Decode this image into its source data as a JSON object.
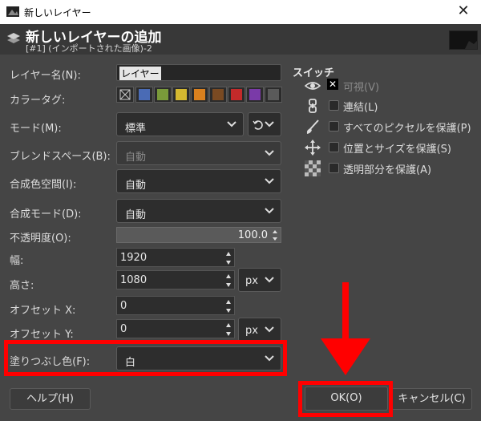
{
  "window": {
    "title": "新しいレイヤー"
  },
  "header": {
    "title": "新しいレイヤーの追加",
    "subtitle": "[#1] (インポートされた画像)-2"
  },
  "form": {
    "layer_name": {
      "label": "レイヤー名(N):",
      "value": "レイヤー"
    },
    "color_tag": {
      "label": "カラータグ:",
      "colors": [
        "#4a6bb5",
        "#7a9a3a",
        "#d4b830",
        "#d9801e",
        "#7a4a22",
        "#c42a2a",
        "#7a3aa8",
        "#5a5a5a"
      ]
    },
    "mode": {
      "label": "モード(M):",
      "value": "標準"
    },
    "blend_space": {
      "label": "ブレンドスペース(B):",
      "value": "自動"
    },
    "composite_space": {
      "label": "合成色空間(I):",
      "value": "自動"
    },
    "composite_mode": {
      "label": "合成モード(D):",
      "value": "自動"
    },
    "opacity": {
      "label": "不透明度(O):",
      "value": "100.0"
    },
    "width": {
      "label": "幅:",
      "value": "1920"
    },
    "height": {
      "label": "高さ:",
      "value": "1080",
      "unit": "px"
    },
    "offset_x": {
      "label": "オフセット X:",
      "value": "0"
    },
    "offset_y": {
      "label": "オフセット Y:",
      "value": "0",
      "unit": "px"
    },
    "fill": {
      "label": "塗りつぶし色(F):",
      "value": "白"
    }
  },
  "switches": {
    "title": "スイッチ",
    "visible": "可視(V)",
    "linked": "連結(L)",
    "lock_pixels": "すべてのピクセルを保護(P)",
    "lock_position": "位置とサイズを保護(S)",
    "lock_alpha": "透明部分を保護(A)"
  },
  "buttons": {
    "help": "ヘルプ(H)",
    "ok": "OK(O)",
    "cancel": "キャンセル(C)"
  },
  "annotation_color": "#ff0000"
}
